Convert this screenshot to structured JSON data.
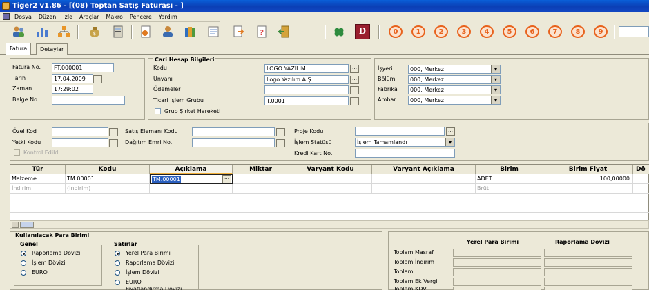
{
  "window": {
    "title": "Tiger2 v1.86 - [(08) Toptan Satış Faturası - ]"
  },
  "menu": [
    "Dosya",
    "Düzen",
    "İzle",
    "Araçlar",
    "Makro",
    "Pencere",
    "Yardım"
  ],
  "toolbar": {
    "letter_button": "D",
    "numbers": [
      "0",
      "1",
      "2",
      "3",
      "4",
      "5",
      "6",
      "7",
      "8",
      "9"
    ]
  },
  "tabs": [
    "Fatura",
    "Detaylar"
  ],
  "header": {
    "fatura_no_label": "Fatura No.",
    "fatura_no": "FT.000001",
    "tarih_label": "Tarih",
    "tarih": "17.04.2009",
    "zaman_label": "Zaman",
    "zaman": "17:29:02",
    "belge_no_label": "Belge No.",
    "belge_no": ""
  },
  "cari": {
    "title": "Cari Hesap Bilgileri",
    "kodu_label": "Kodu",
    "kodu": "LOGO YAZILIM",
    "unvani_label": "Unvanı",
    "unvani": "Logo Yazılım A.Ş",
    "odemeler_label": "Ödemeler",
    "odemeler": "",
    "ticari_label": "Ticari İşlem Grubu",
    "ticari": "T.0001",
    "grup_label": "Grup Şirket Hareketi"
  },
  "org": {
    "isyeri_label": "İşyeri",
    "isyeri": "000, Merkez",
    "bolum_label": "Bölüm",
    "bolum": "000, Merkez",
    "fabrika_label": "Fabrika",
    "fabrika": "000, Merkez",
    "ambar_label": "Ambar",
    "ambar": "000, Merkez"
  },
  "codes": {
    "ozel_kod_label": "Özel Kod",
    "yetki_kodu_label": "Yetki Kodu",
    "kontrol_label": "Kontrol Edildi",
    "satis_label": "Satış Elemanı Kodu",
    "dagitim_label": "Dağıtım Emri No.",
    "proje_label": "Proje Kodu",
    "islem_statusu_label": "İşlem Statüsü",
    "islem_statusu": "İşlem Tamamlandı",
    "kredi_label": "Kredi Kart No."
  },
  "grid": {
    "columns": [
      "Tür",
      "Kodu",
      "Açıklama",
      "Miktar",
      "Varyant Kodu",
      "Varyant Açıklama",
      "Birim",
      "Birim Fiyat",
      "Dö"
    ],
    "rows": [
      [
        "Malzeme",
        "TM.00001",
        "TM.00001",
        "",
        "",
        "",
        "ADET",
        "100,00000",
        ""
      ],
      [
        "İndirim",
        "(İndirim)",
        "",
        "",
        "",
        "",
        "Brüt",
        "",
        ""
      ]
    ]
  },
  "currency": {
    "title": "Kullanılacak Para Birimi",
    "genel_title": "Genel",
    "genel_options": [
      "Raporlama Dövizi",
      "İşlem Dövizi",
      "EURO"
    ],
    "satirlar_title": "Satırlar",
    "satirlar_options": [
      "Yerel Para Birimi",
      "Raporlama Dövizi",
      "İşlem Dövizi",
      "EURO",
      "Fiyatlandırma Dövizi"
    ]
  },
  "totals": {
    "col1": "Yerel Para Birimi",
    "col2": "Raporlama Dövizi",
    "rows": [
      "Toplam Masraf",
      "Toplam İndirim",
      "Toplam",
      "Toplam Ek Vergi",
      "Toplam KDV"
    ]
  }
}
